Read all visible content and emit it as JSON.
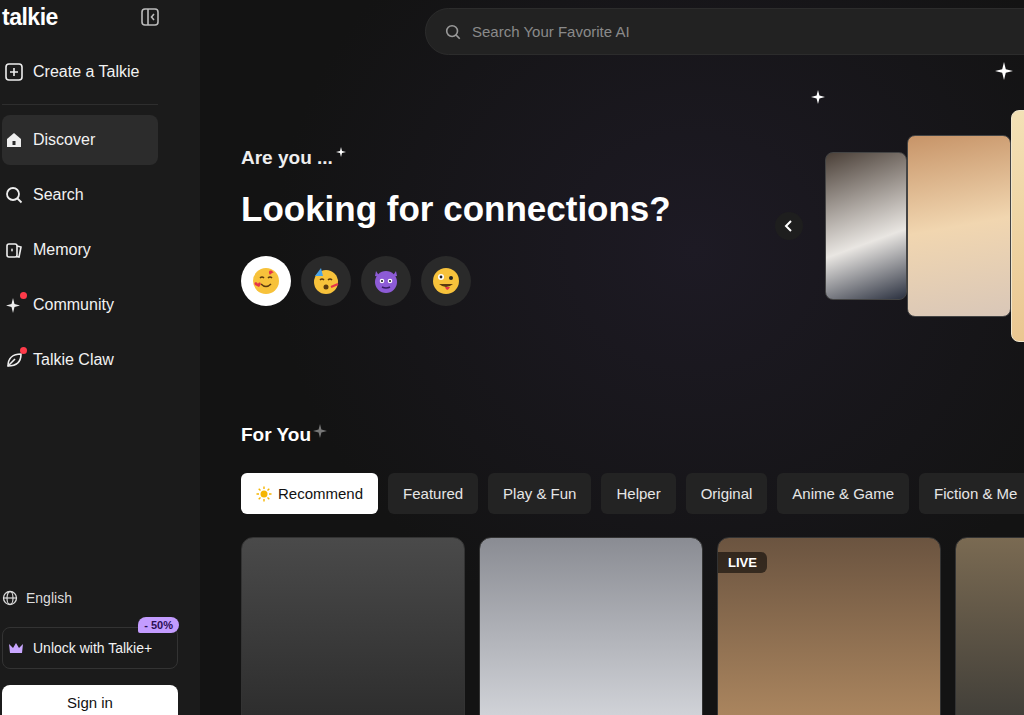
{
  "logo": "talkie",
  "sidebar": {
    "create": "Create a Talkie",
    "items": [
      {
        "label": "Discover",
        "selected": true,
        "badge": false
      },
      {
        "label": "Search",
        "selected": false,
        "badge": false
      },
      {
        "label": "Memory",
        "selected": false,
        "badge": false
      },
      {
        "label": "Community",
        "selected": false,
        "badge": true
      },
      {
        "label": "Talkie Claw",
        "selected": false,
        "badge": true
      }
    ],
    "language": "English",
    "upgrade": {
      "label": "Unlock with Talkie+",
      "badge": "- 50%"
    },
    "signin": "Sign in"
  },
  "search": {
    "placeholder": "Search Your Favorite AI"
  },
  "hero": {
    "eyebrow": "Are you ...",
    "title": "Looking for connections?",
    "moods": [
      {
        "selected": true
      },
      {
        "selected": false
      },
      {
        "selected": false
      },
      {
        "selected": false
      }
    ],
    "slides": [
      {
        "selected": false
      },
      {
        "selected": false
      },
      {
        "selected": true
      }
    ]
  },
  "for_you": {
    "title": "For You",
    "tabs": [
      {
        "label": "Recommend",
        "selected": true
      },
      {
        "label": "Featured",
        "selected": false
      },
      {
        "label": "Play & Fun",
        "selected": false
      },
      {
        "label": "Helper",
        "selected": false
      },
      {
        "label": "Original",
        "selected": false
      },
      {
        "label": "Anime & Game",
        "selected": false
      },
      {
        "label": "Fiction & Me",
        "selected": false
      }
    ],
    "cards": [
      {
        "badge": ""
      },
      {
        "badge": ""
      },
      {
        "badge": "LIVE"
      },
      {
        "badge": ""
      }
    ]
  }
}
